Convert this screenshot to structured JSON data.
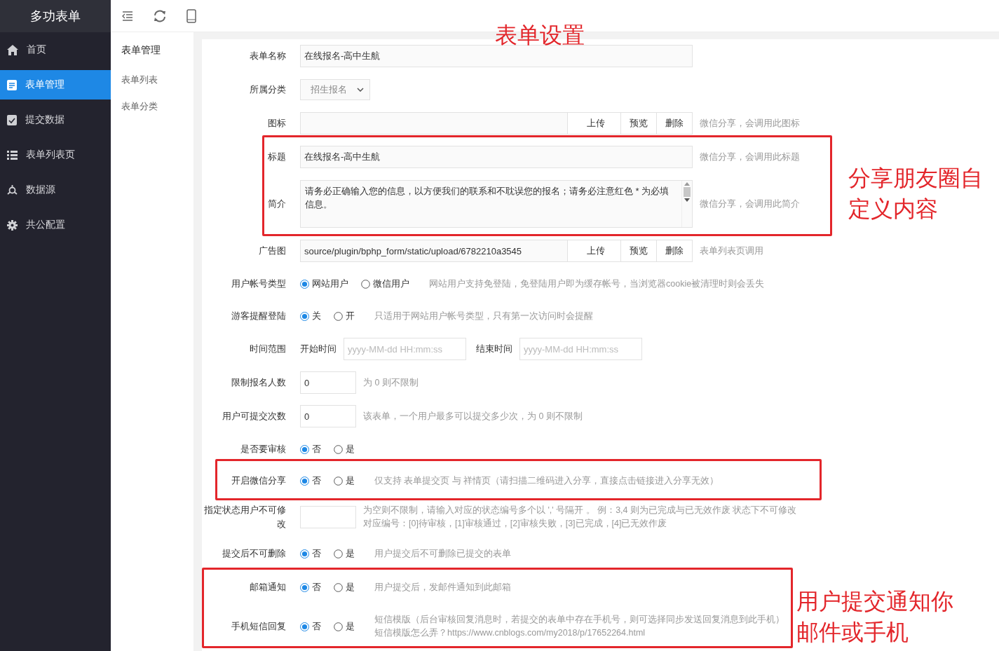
{
  "app_title": "多功表单",
  "sidebar": {
    "items": [
      {
        "label": "首页",
        "selected": false
      },
      {
        "label": "表单管理",
        "selected": true
      },
      {
        "label": "提交数据",
        "selected": false
      },
      {
        "label": "表单列表页",
        "selected": false
      },
      {
        "label": "数据源",
        "selected": false
      },
      {
        "label": "共公配置",
        "selected": false
      }
    ]
  },
  "submenu": {
    "title": "表单管理",
    "items": [
      {
        "label": "表单列表"
      },
      {
        "label": "表单分类"
      }
    ]
  },
  "form": {
    "rows": [
      {
        "kind": "text",
        "label": "表单名称",
        "value": "在线报名-高中生航"
      },
      {
        "kind": "select",
        "label": "所属分类",
        "value": "招生报名"
      },
      {
        "kind": "upload",
        "label": "图标",
        "value": "",
        "buttons": [
          "上传",
          "预览",
          "删除"
        ],
        "hint": "微信分享，会调用此图标"
      },
      {
        "kind": "text",
        "label": "标题",
        "value": "在线报名-高中生航",
        "hint": "微信分享，会调用此标题"
      },
      {
        "kind": "textarea",
        "label": "简介",
        "value": "请务必正确输入您的信息，以方便我们的联系和不耽误您的报名；请务必注意红色 * 为必填信息。",
        "hint": "微信分享，会调用此简介"
      },
      {
        "kind": "upload",
        "label": "广告图",
        "value": "source/plugin/bphp_form/static/upload/6782210a3545",
        "buttons": [
          "上传",
          "预览",
          "删除"
        ],
        "hint": "表单列表页调用"
      },
      {
        "kind": "radio",
        "label": "用户帐号类型",
        "options": [
          {
            "label": "网站用户",
            "selected": true
          },
          {
            "label": "微信用户",
            "selected": false
          }
        ],
        "hint": "网站用户支持免登陆，免登陆用户即为缓存帐号，当浏览器cookie被清理时则会丢失"
      },
      {
        "kind": "radio",
        "label": "游客提醒登陆",
        "options": [
          {
            "label": "关",
            "selected": true
          },
          {
            "label": "开",
            "selected": false
          }
        ],
        "hint": "只适用于网站用户帐号类型，只有第一次访问时会提醒"
      },
      {
        "kind": "daterange",
        "label": "时间范围",
        "start_label": "开始时间",
        "start_placeholder": "yyyy-MM-dd HH:mm:ss",
        "end_label": "结束时间",
        "end_placeholder": "yyyy-MM-dd HH:mm:ss"
      },
      {
        "kind": "number",
        "label": "限制报名人数",
        "value": "0",
        "hint": "为 0 则不限制"
      },
      {
        "kind": "number",
        "label": "用户可提交次数",
        "value": "0",
        "hint": "该表单，一个用户最多可以提交多少次，为 0 则不限制"
      },
      {
        "kind": "radio",
        "label": "是否要审核",
        "options": [
          {
            "label": "否",
            "selected": true
          },
          {
            "label": "是",
            "selected": false
          }
        ]
      },
      {
        "kind": "radio",
        "label": "开启微信分享",
        "options": [
          {
            "label": "否",
            "selected": true
          },
          {
            "label": "是",
            "selected": false
          }
        ],
        "hint": "仅支持 表单提交页 与 祥情页（请扫描二维码进入分享，直接点击链接进入分享无效）"
      },
      {
        "kind": "number",
        "label": "指定状态用户不可修改",
        "value": "",
        "hint_lines": [
          "为空则不限制，请输入对应的状态编号多个以 ',' 号隔开 。 例：3,4 则为已完成与已无效作废 状态下不可修改",
          "对应编号：[0]待审核，[1]审核通过，[2]审核失败，[3]已完成，[4]已无效作废"
        ]
      },
      {
        "kind": "radio",
        "label": "提交后不可删除",
        "options": [
          {
            "label": "否",
            "selected": true
          },
          {
            "label": "是",
            "selected": false
          }
        ],
        "hint": "用户提交后不可删除已提交的表单"
      },
      {
        "kind": "radio",
        "label": "邮箱通知",
        "options": [
          {
            "label": "否",
            "selected": true
          },
          {
            "label": "是",
            "selected": false
          }
        ],
        "hint": "用户提交后，发邮件通知到此邮箱"
      },
      {
        "kind": "radio",
        "label": "手机短信回复",
        "options": [
          {
            "label": "否",
            "selected": true
          },
          {
            "label": "是",
            "selected": false
          }
        ],
        "hint_lines": [
          "短信模版（后台审核回复消息时，若提交的表单中存在手机号，则可选择同步发送回复消息到此手机）",
          "短信模版怎么弄？https://www.cnblogs.com/my2018/p/17652264.html"
        ]
      }
    ]
  },
  "annotations": [
    {
      "kind": "note",
      "text": "表单设置"
    },
    {
      "kind": "box"
    },
    {
      "kind": "note",
      "text": "分享朋友圈自定义内容"
    },
    {
      "kind": "box"
    },
    {
      "kind": "box"
    },
    {
      "kind": "note",
      "text": "用户提交通知你邮件或手机"
    }
  ]
}
